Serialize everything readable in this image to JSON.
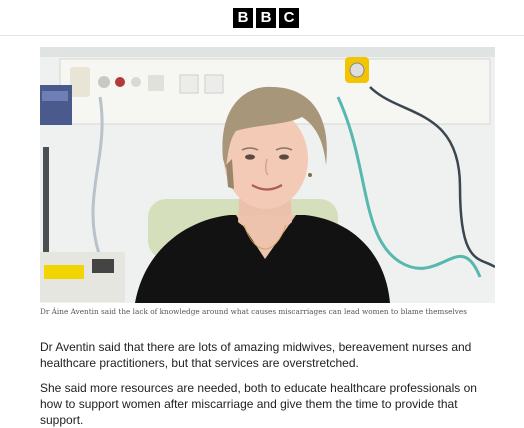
{
  "header": {
    "logo_letters": [
      "B",
      "B",
      "C"
    ],
    "background": "#ffffff"
  },
  "article": {
    "image_icon": "portrait-photo",
    "caption": "Dr Áine Aventin said the lack of knowledge around what causes miscarriages can lead women to blame themselves",
    "paragraphs": [
      "Dr Aventin said that there are lots of amazing midwives, bereavement nurses and healthcare practitioners, but that services are overstretched.",
      "She said more resources are needed, both to educate healthcare professionals on how to support women after miscarriage and give them the time to provide that support."
    ]
  },
  "colors": {
    "logo_bg": "#000000",
    "logo_fg": "#ffffff",
    "caption": "#545658",
    "body_text": "#202224"
  }
}
